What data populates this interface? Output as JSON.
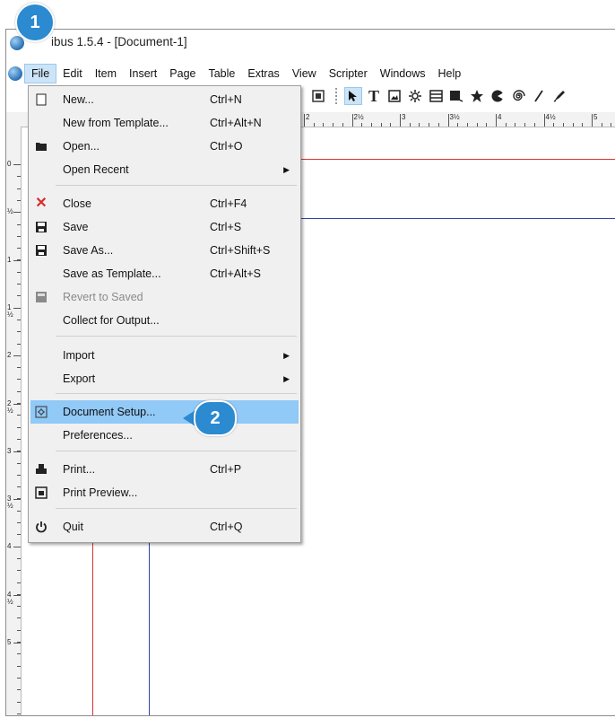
{
  "window": {
    "title": "ibus 1.5.4 - [Document-1]"
  },
  "menubar": [
    "File",
    "Edit",
    "Item",
    "Insert",
    "Page",
    "Table",
    "Extras",
    "View",
    "Scripter",
    "Windows",
    "Help"
  ],
  "toolbar_icons": [
    "pdf-icon",
    "select-icon",
    "text-frame-icon",
    "image-frame-icon",
    "render-frame-icon",
    "table-icon",
    "shape-icon",
    "polygon-icon",
    "arc-icon",
    "spiral-icon",
    "line-icon",
    "bezier-icon"
  ],
  "ruler": {
    "top": [
      "2",
      "2½",
      "3",
      "3½",
      "4",
      "4½",
      "5"
    ],
    "left": [
      "0",
      "½",
      "1",
      "1\n½",
      "2",
      "2\n½",
      "3",
      "3\n½",
      "4",
      "4\n½",
      "5"
    ]
  },
  "file_menu": {
    "items": [
      {
        "label": "New...",
        "shortcut": "Ctrl+N",
        "icon": "new-document-icon"
      },
      {
        "label": "New from Template...",
        "shortcut": "Ctrl+Alt+N",
        "icon": ""
      },
      {
        "label": "Open...",
        "shortcut": "Ctrl+O",
        "icon": "folder-icon"
      },
      {
        "label": "Open Recent",
        "shortcut": "",
        "icon": "",
        "submenu": true
      },
      {
        "label": "Close",
        "shortcut": "Ctrl+F4",
        "icon": "close-icon"
      },
      {
        "label": "Save",
        "shortcut": "Ctrl+S",
        "icon": "save-icon"
      },
      {
        "label": "Save As...",
        "shortcut": "Ctrl+Shift+S",
        "icon": "save-as-icon"
      },
      {
        "label": "Save as Template...",
        "shortcut": "Ctrl+Alt+S",
        "icon": ""
      },
      {
        "label": "Revert to Saved",
        "shortcut": "",
        "icon": "revert-icon",
        "disabled": true
      },
      {
        "label": "Collect for Output...",
        "shortcut": "",
        "icon": ""
      },
      {
        "label": "Import",
        "shortcut": "",
        "icon": "",
        "submenu": true
      },
      {
        "label": "Export",
        "shortcut": "",
        "icon": "",
        "submenu": true
      },
      {
        "label": "Document Setup...",
        "shortcut": "",
        "icon": "document-setup-icon",
        "highlighted": true
      },
      {
        "label": "Preferences...",
        "shortcut": "",
        "icon": ""
      },
      {
        "label": "Print...",
        "shortcut": "Ctrl+P",
        "icon": "print-icon"
      },
      {
        "label": "Print Preview...",
        "shortcut": "",
        "icon": "print-preview-icon"
      },
      {
        "label": "Quit",
        "shortcut": "Ctrl+Q",
        "icon": "power-icon"
      }
    ]
  },
  "callouts": {
    "step1": "1",
    "step2": "2"
  },
  "colors": {
    "highlight": "#91c9f7",
    "callout": "#2b8ad0",
    "margin_red": "#dd3333",
    "margin_blue": "#3245a8"
  }
}
